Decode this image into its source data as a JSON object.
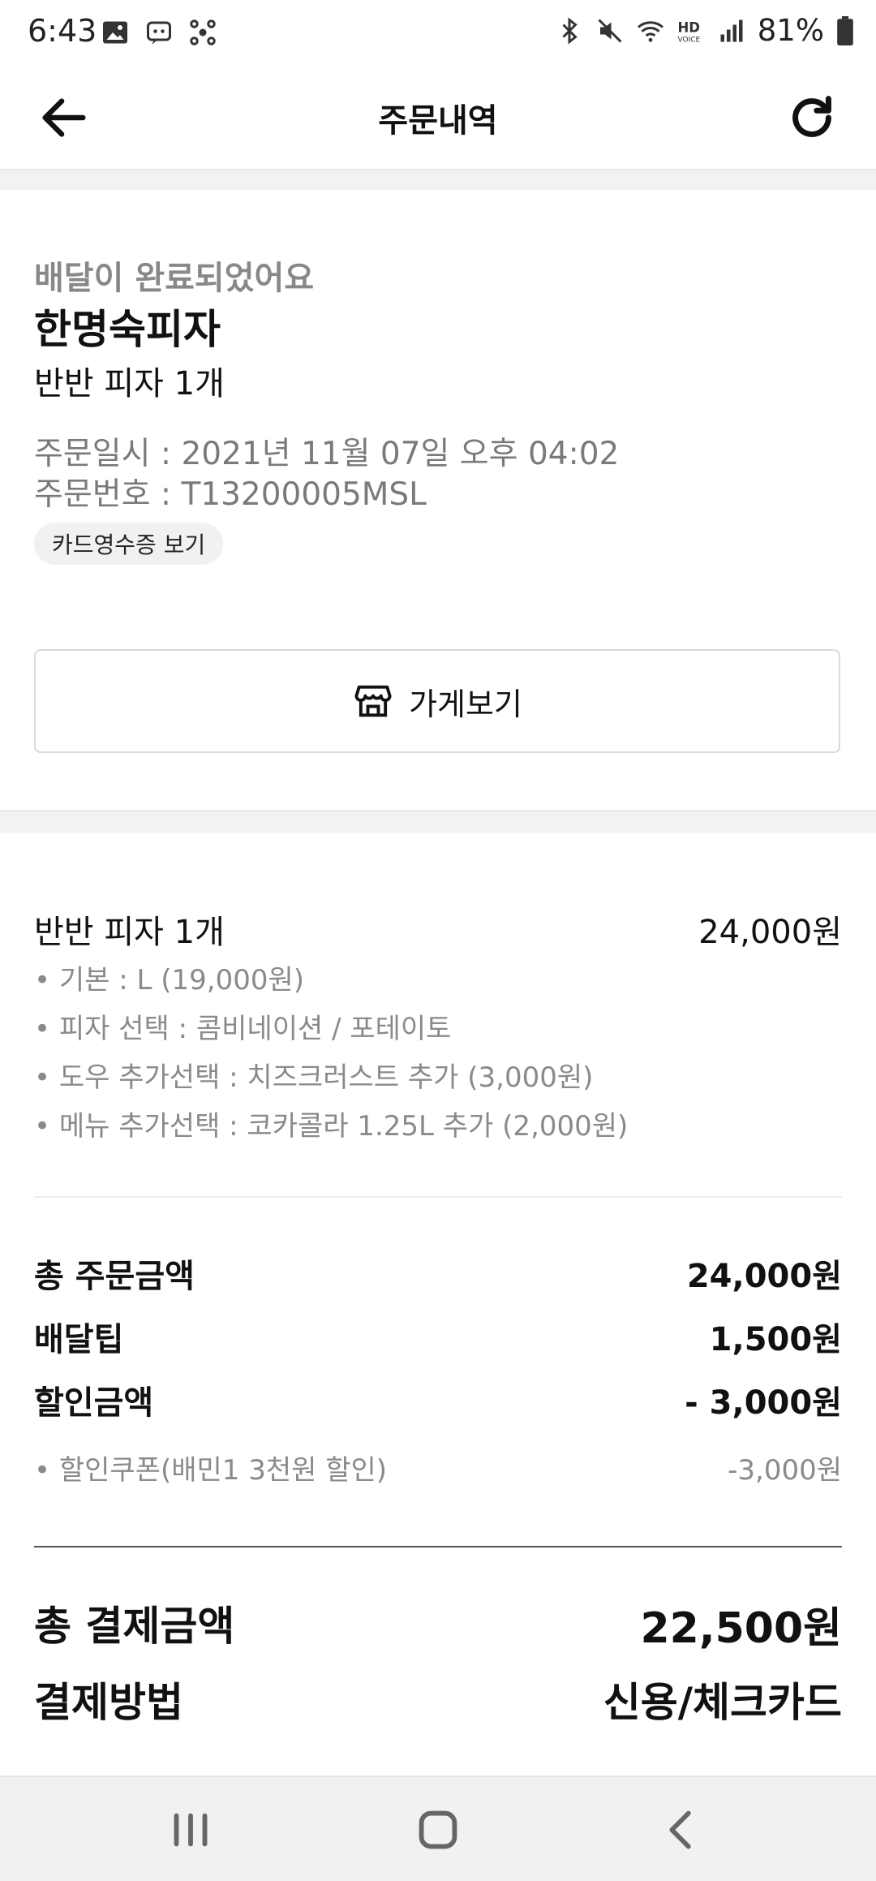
{
  "status_bar": {
    "time": "6:43",
    "left_icons": [
      "image-icon",
      "chat-bot-icon",
      "connection-icon"
    ],
    "right_icons": [
      "bluetooth-icon",
      "mute-icon",
      "wifi-icon",
      "hd-voice-icon",
      "signal-icon"
    ],
    "battery_text": "81%"
  },
  "header": {
    "title": "주문내역",
    "back_icon": "arrow-left-icon",
    "refresh_icon": "refresh-icon"
  },
  "order": {
    "status": "배달이 완료되었어요",
    "store_name": "한명숙피자",
    "summary": "반반 피자 1개",
    "date": "주문일시 : 2021년 11월 07일 오후 04:02",
    "number": "주문번호 : T13200005MSL",
    "receipt_button": "카드영수증 보기",
    "store_button": "가게보기"
  },
  "menu": {
    "name": "반반 피자 1개",
    "price": "24,000원",
    "options": [
      "• 기본 : L (19,000원)",
      "• 피자 선택 : 콤비네이션 / 포테이토",
      "• 도우 추가선택 : 치즈크러스트 추가 (3,000원)",
      "• 메뉴 추가선택 : 코카콜라 1.25L 추가 (2,000원)"
    ]
  },
  "summary": {
    "order_total_label": "총 주문금액",
    "order_total_value": "24,000원",
    "delivery_tip_label": "배달팁",
    "delivery_tip_value": "1,500원",
    "discount_label": "할인금액",
    "discount_value": "- 3,000원",
    "coupon_label": "• 할인쿠폰(배민1 3천원 할인)",
    "coupon_value": "-3,000원",
    "payment_total_label": "총 결제금액",
    "payment_total_value": "22,500원",
    "payment_method_label": "결제방법",
    "payment_method_value": "신용/체크카드"
  },
  "nav": {
    "recent_icon": "recent-apps-icon",
    "home_icon": "home-icon",
    "back_icon": "back-icon"
  }
}
